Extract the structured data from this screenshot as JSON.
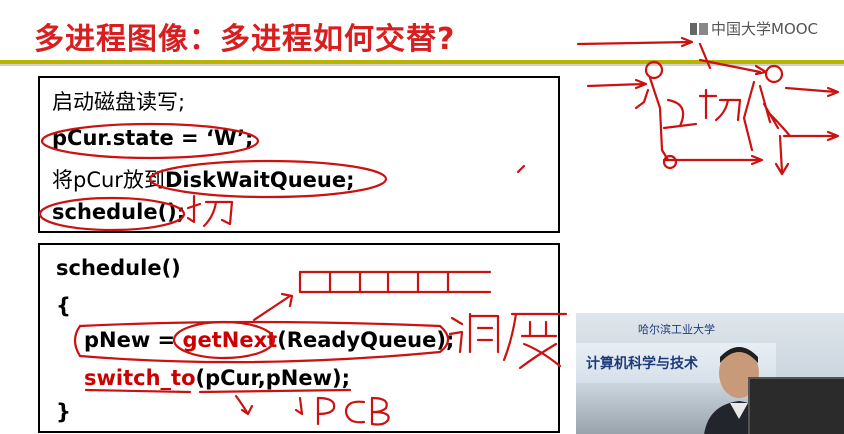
{
  "slide": {
    "title": "多进程图像：多进程如何交替?",
    "logo_text": "中国大学MOOC"
  },
  "box1": {
    "line1": "启动磁盘读写;",
    "line2": "pCur.state = ‘W’;",
    "line3_prefix": "将pCur放到",
    "line3_suffix": "DiskWaitQueue;",
    "line4": "schedule();"
  },
  "box2": {
    "line1": "schedule()",
    "line2": "{",
    "line3_a": "pNew = ",
    "line3_b": "getNext",
    "line3_c": "(ReadyQueue);",
    "line4_a": "switch_to",
    "line4_b": "(pCur,pNew);",
    "line5": "}"
  },
  "video": {
    "banner_sub": "哈尔滨工业大学",
    "banner_main": "计算机科学与技术"
  },
  "colors": {
    "title": "#d81e1e",
    "accent_rule": "#b8b400",
    "ink": "#cc1111",
    "code_red": "#cc0000"
  }
}
